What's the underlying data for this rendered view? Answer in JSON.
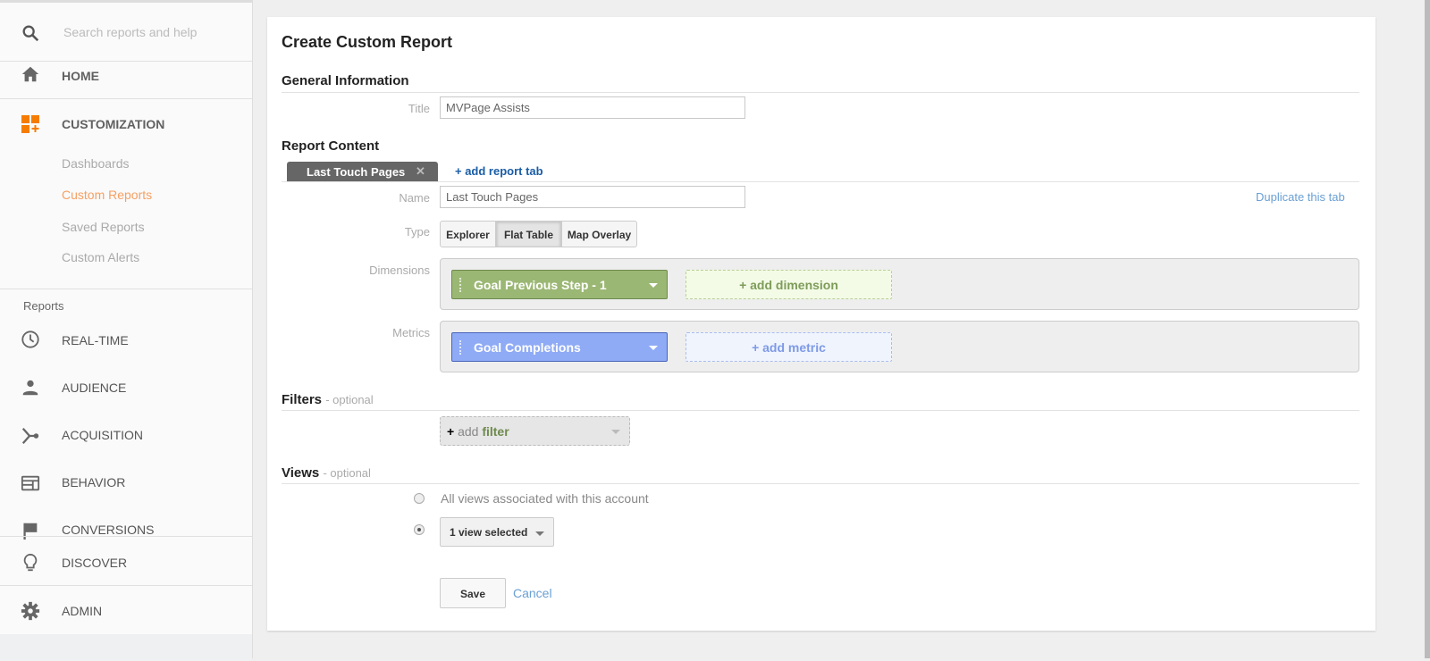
{
  "sidebar": {
    "search_placeholder": "Search reports and help",
    "home": "HOME",
    "customization": "CUSTOMIZATION",
    "sub_items": [
      "Dashboards",
      "Custom Reports",
      "Saved Reports",
      "Custom Alerts"
    ],
    "reports_heading": "Reports",
    "reports": [
      "REAL-TIME",
      "AUDIENCE",
      "ACQUISITION",
      "BEHAVIOR",
      "CONVERSIONS"
    ],
    "discover": "DISCOVER",
    "admin": "ADMIN"
  },
  "main": {
    "title": "Create Custom Report",
    "general_heading": "General Information",
    "title_label": "Title",
    "title_value": "MVPage Assists",
    "content_heading": "Report Content",
    "tab_label": "Last Touch Pages",
    "add_tab": "+ add report tab",
    "name_label": "Name",
    "name_value": "Last Touch Pages",
    "duplicate": "Duplicate this tab",
    "type_label": "Type",
    "types": [
      "Explorer",
      "Flat Table",
      "Map Overlay"
    ],
    "dimensions_label": "Dimensions",
    "dimension": "Goal Previous Step - 1",
    "add_dimension": "+ add dimension",
    "metrics_label": "Metrics",
    "metric": "Goal Completions",
    "add_metric": "+ add metric",
    "filters_heading": "Filters",
    "optional": "- optional",
    "filter_plus": "+",
    "filter_add": "add",
    "filter_word": "filter",
    "views_heading": "Views",
    "views_all": "All views associated with this account",
    "views_selected": "1 view selected",
    "save": "Save",
    "cancel": "Cancel"
  },
  "colors": {
    "accent": "#f57c00",
    "dimension": "#9bb774",
    "metric": "#8fabf5",
    "link": "#5b9bd5"
  }
}
